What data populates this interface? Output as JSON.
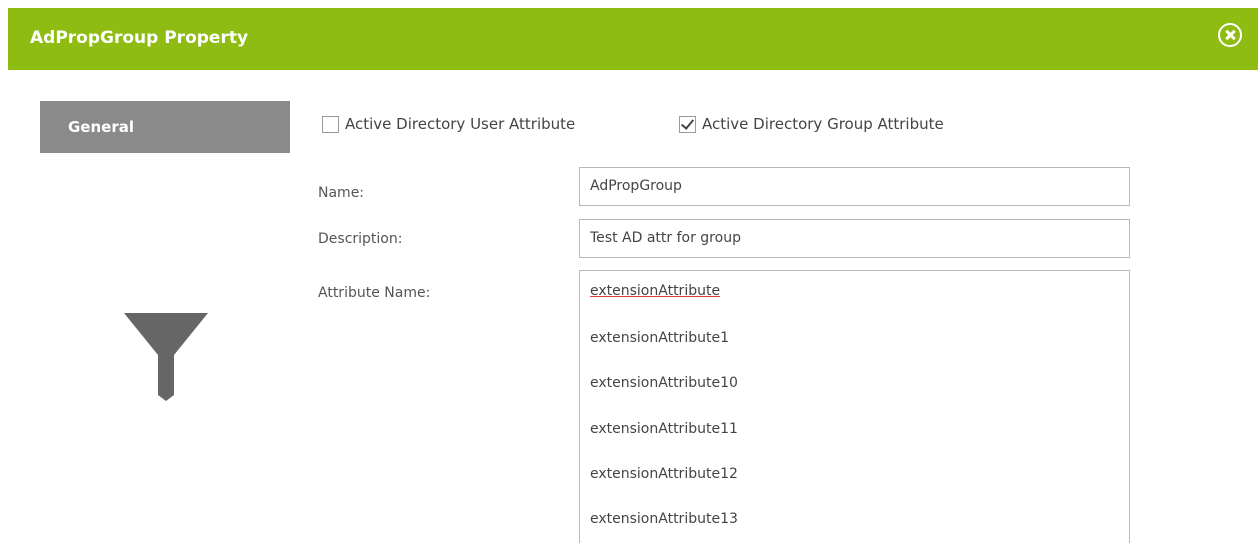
{
  "dialog": {
    "title": "AdPropGroup Property"
  },
  "sidebar": {
    "tab_label": "General"
  },
  "checkboxes": {
    "user_attr_label": "Active Directory User Attribute",
    "user_attr_checked": false,
    "group_attr_label": "Active Directory Group Attribute",
    "group_attr_checked": true
  },
  "fields": {
    "name_label": "Name:",
    "name_value": "AdPropGroup",
    "description_label": "Description:",
    "description_value": "Test AD attr for group",
    "attribute_name_label": "Attribute Name:",
    "attribute_name_value": "extensionAttribute"
  },
  "dropdown": {
    "options": [
      "extensionAttribute1",
      "extensionAttribute10",
      "extensionAttribute11",
      "extensionAttribute12",
      "extensionAttribute13"
    ]
  },
  "colors": {
    "titlebar": "#8fbc12",
    "sidebar_tab": "#8a8a8a",
    "filter_icon": "#666666"
  },
  "icons": {
    "close": "close-circle-icon",
    "filter": "filter-icon",
    "check": "checkmark-icon"
  }
}
